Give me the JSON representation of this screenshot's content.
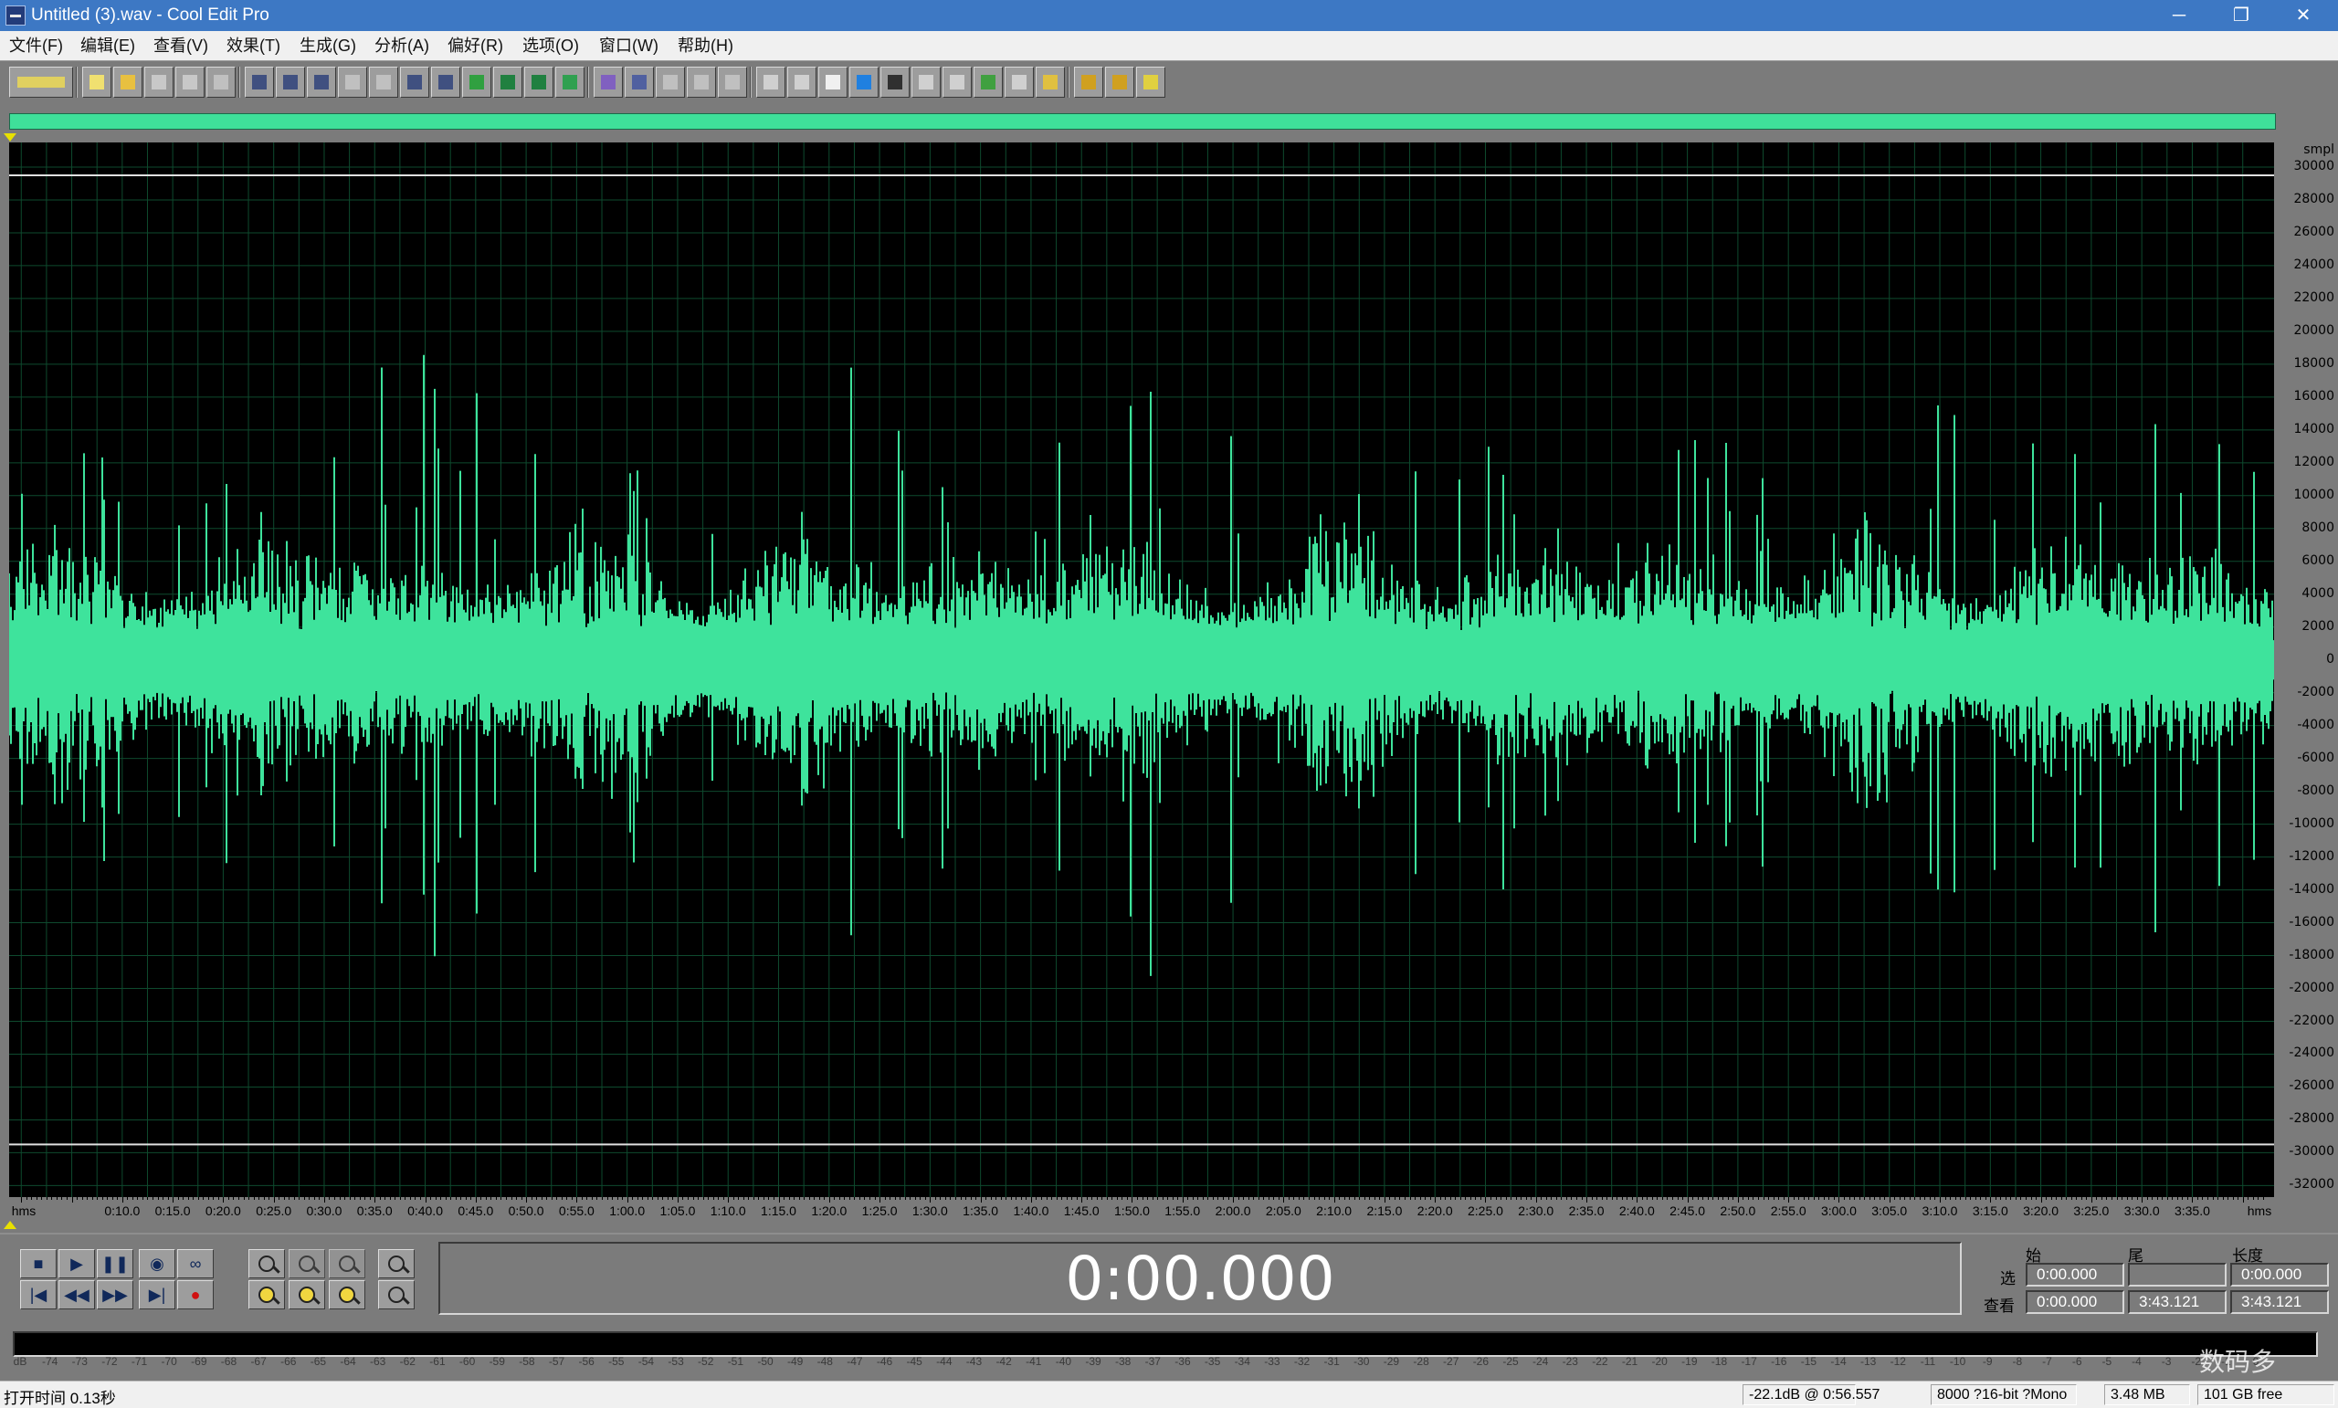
{
  "window": {
    "title": "Untitled (3).wav - Cool Edit Pro",
    "minimize": "─",
    "restore": "❐",
    "close": "✕"
  },
  "menu": [
    "文件(F)",
    "编辑(E)",
    "查看(V)",
    "效果(T)",
    "生成(G)",
    "分析(A)",
    "偏好(R)",
    "选项(O)",
    "窗口(W)",
    "帮助(H)"
  ],
  "toolbar": {
    "icons": [
      "multitrack-view-icon",
      "new-file-icon",
      "open-file-icon",
      "save-icon",
      "save-as-icon",
      "close-file-icon",
      "undo-icon",
      "redo-icon",
      "repeat-last-icon",
      "copy-new-icon",
      "copy-icon",
      "cut-icon",
      "paste-icon",
      "paste-new-icon",
      "paste-mix-icon",
      "clip-icon",
      "play-icon",
      "spectral-view-icon",
      "spectrum-analysis-icon",
      "zoom-full-icon",
      "zoom-sel-icon",
      "zoom-out-icon",
      "window-icon",
      "show-info-icon",
      "cue-icon",
      "time-display-icon",
      "transport-icon",
      "zoom-icon",
      "time-icon",
      "level-icon",
      "status-icon",
      "frequency-analysis-icon",
      "scripts-icon",
      "settings-icon",
      "help-icon"
    ]
  },
  "waveform": {
    "unit_label": "smpl",
    "amplitude_ticks": [
      "30000",
      "28000",
      "26000",
      "24000",
      "22000",
      "20000",
      "18000",
      "16000",
      "14000",
      "12000",
      "10000",
      "8000",
      "6000",
      "4000",
      "2000",
      "0",
      "-2000",
      "-4000",
      "-6000",
      "-8000",
      "-10000",
      "-12000",
      "-14000",
      "-16000",
      "-18000",
      "-20000",
      "-22000",
      "-24000",
      "-26000",
      "-28000",
      "-30000",
      "-32000"
    ],
    "time_ticks": [
      "0:10.0",
      "0:15.0",
      "0:20.0",
      "0:25.0",
      "0:30.0",
      "0:35.0",
      "0:40.0",
      "0:45.0",
      "0:50.0",
      "0:55.0",
      "1:00.0",
      "1:05.0",
      "1:10.0",
      "1:15.0",
      "1:20.0",
      "1:25.0",
      "1:30.0",
      "1:35.0",
      "1:40.0",
      "1:45.0",
      "1:50.0",
      "1:55.0",
      "2:00.0",
      "2:05.0",
      "2:10.0",
      "2:15.0",
      "2:20.0",
      "2:25.0",
      "2:30.0",
      "2:35.0",
      "2:40.0",
      "2:45.0",
      "2:50.0",
      "2:55.0",
      "3:00.0",
      "3:05.0",
      "3:10.0",
      "3:15.0",
      "3:20.0",
      "3:25.0",
      "3:30.0",
      "3:35.0"
    ],
    "time_unit_left": "hms",
    "time_unit_right": "hms",
    "wave_color": "#3ee39c",
    "background": "#000000",
    "grid_color": "#0e4a2e",
    "peaks": [
      21000,
      -20000,
      20000,
      -18000,
      20000,
      -17000,
      19000,
      -20000,
      21000,
      -16000,
      17000,
      -19000
    ]
  },
  "transport": {
    "buttons": [
      "■",
      "▶",
      "❚❚",
      "◉",
      "∞",
      "|◀",
      "◀◀",
      "▶▶",
      "▶|",
      "●"
    ],
    "big_time": "0:00.000",
    "zoom_buttons": [
      "zoom-in-icon",
      "zoom-out-icon",
      "zoom-full-icon",
      "zoom-in-vertical-icon",
      "zoom-sel-icon",
      "zoom-left-icon",
      "zoom-right-icon",
      "zoom-out-vertical-icon"
    ]
  },
  "selection": {
    "head_begin": "始",
    "head_end": "尾",
    "head_length": "长度",
    "row_sel_label": "选",
    "row_view_label": "查看",
    "sel_begin": "0:00.000",
    "sel_end": "",
    "sel_length": "0:00.000",
    "view_begin": "0:00.000",
    "view_end": "3:43.121",
    "view_length": "3:43.121"
  },
  "meter": {
    "labels": [
      "dB",
      "-74",
      "-73",
      "-72",
      "-71",
      "-70",
      "-69",
      "-68",
      "-67",
      "-66",
      "-65",
      "-64",
      "-63",
      "-62",
      "-61",
      "-60",
      "-59",
      "-58",
      "-57",
      "-56",
      "-55",
      "-54",
      "-53",
      "-52",
      "-51",
      "-50",
      "-49",
      "-48",
      "-47",
      "-46",
      "-45",
      "-44",
      "-43",
      "-42",
      "-41",
      "-40",
      "-39",
      "-38",
      "-37",
      "-36",
      "-35",
      "-34",
      "-33",
      "-32",
      "-31",
      "-30",
      "-29",
      "-28",
      "-27",
      "-26",
      "-25",
      "-24",
      "-23",
      "-22",
      "-21",
      "-20",
      "-19",
      "-18",
      "-17",
      "-16",
      "-15",
      "-14",
      "-13",
      "-12",
      "-11",
      "-10",
      "-9",
      "-8",
      "-7",
      "-6",
      "-5",
      "-4",
      "-3",
      "-2",
      "-1",
      "0"
    ]
  },
  "status": {
    "open_time": "打开时间  0.13秒",
    "level": "-22.1dB @    0:56.557",
    "format": "8000 ?16-bit ?Mono",
    "size": "3.48 MB",
    "free": "101 GB free"
  },
  "watermark": "数码多"
}
